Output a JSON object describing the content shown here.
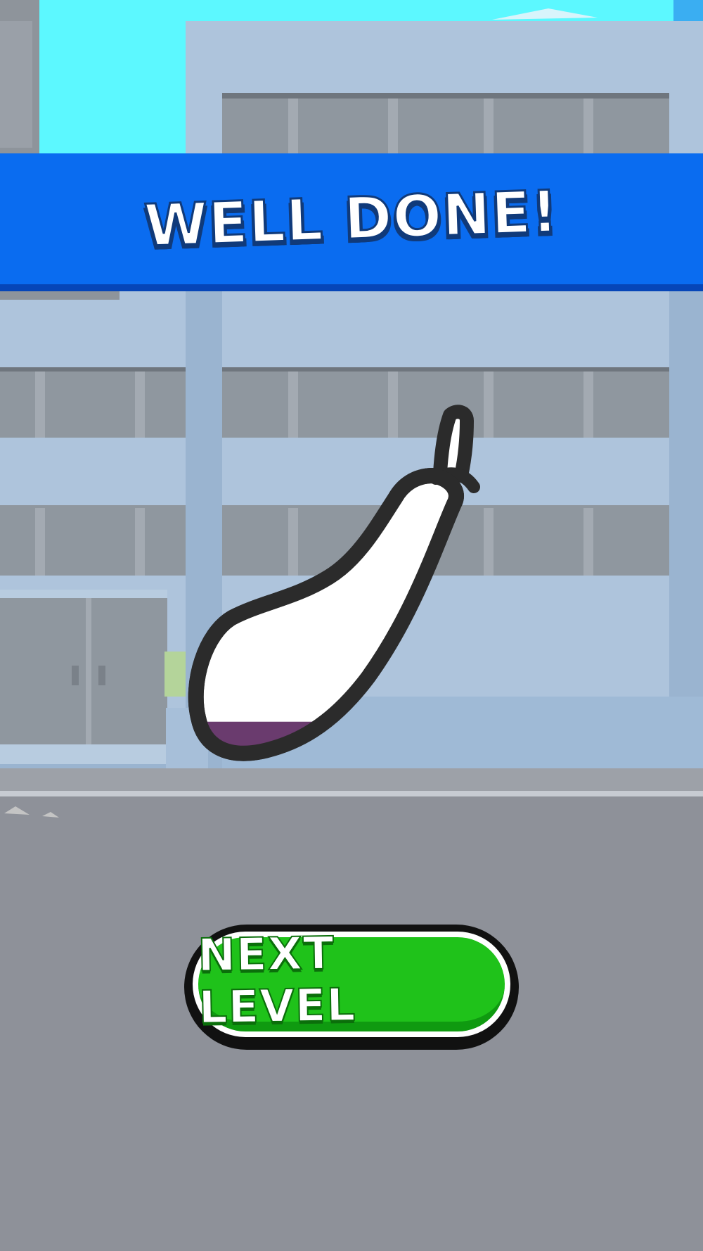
{
  "result": {
    "title": "WELL DONE!"
  },
  "next_button": {
    "label": "NEXT LEVEL"
  },
  "eggplant": {
    "fill_fraction": 0.13,
    "fill_color": "#6a3b6e",
    "outline_color": "#2b2b2b"
  },
  "colors": {
    "banner": "#0a6cf0",
    "button": "#1fc21a",
    "sky": "#5cf8ff",
    "ground": "#8e9199"
  }
}
